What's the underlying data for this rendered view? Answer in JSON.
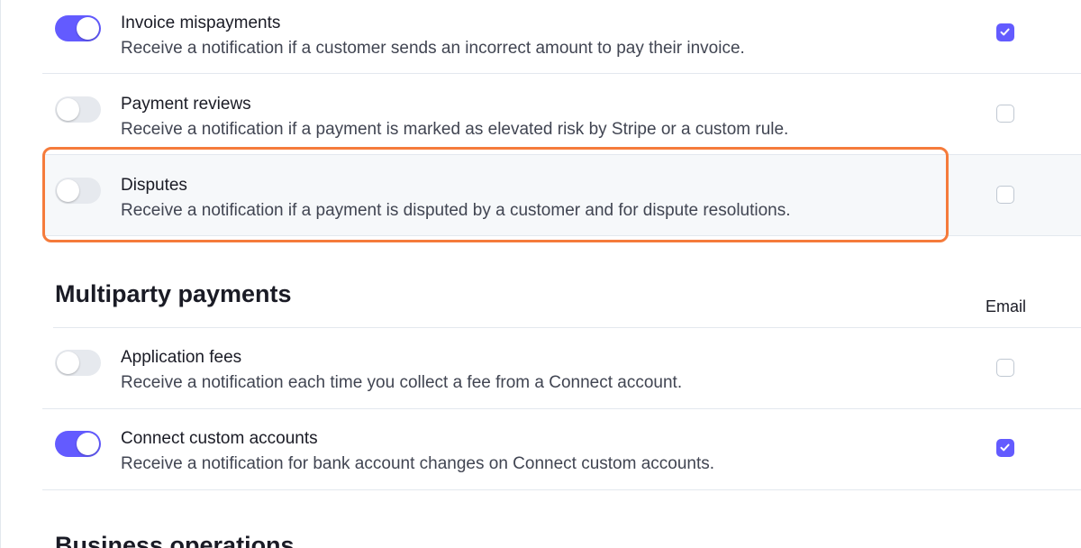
{
  "notifications": {
    "rows_top": [
      {
        "title": "Invoice mispayments",
        "description": "Receive a notification if a customer sends an incorrect amount to pay their invoice.",
        "toggle_on": true,
        "email_checked": true
      },
      {
        "title": "Payment reviews",
        "description": "Receive a notification if a payment is marked as elevated risk by Stripe or a custom rule.",
        "toggle_on": false,
        "email_checked": false
      },
      {
        "title": "Disputes",
        "description": "Receive a notification if a payment is disputed by a customer and for dispute resolutions.",
        "toggle_on": false,
        "email_checked": false,
        "highlighted": true
      }
    ]
  },
  "multiparty": {
    "heading": "Multiparty payments",
    "email_column_label": "Email",
    "rows": [
      {
        "title": "Application fees",
        "description": "Receive a notification each time you collect a fee from a Connect account.",
        "toggle_on": false,
        "email_checked": false
      },
      {
        "title": "Connect custom accounts",
        "description": "Receive a notification for bank account changes on Connect custom accounts.",
        "toggle_on": true,
        "email_checked": true
      }
    ]
  },
  "business_operations": {
    "heading": "Business operations"
  },
  "colors": {
    "accent": "#635bff",
    "highlight_outline": "#f57b3b",
    "toggle_off": "#e6e9ee",
    "row_highlight_bg": "#f6f8fa"
  }
}
